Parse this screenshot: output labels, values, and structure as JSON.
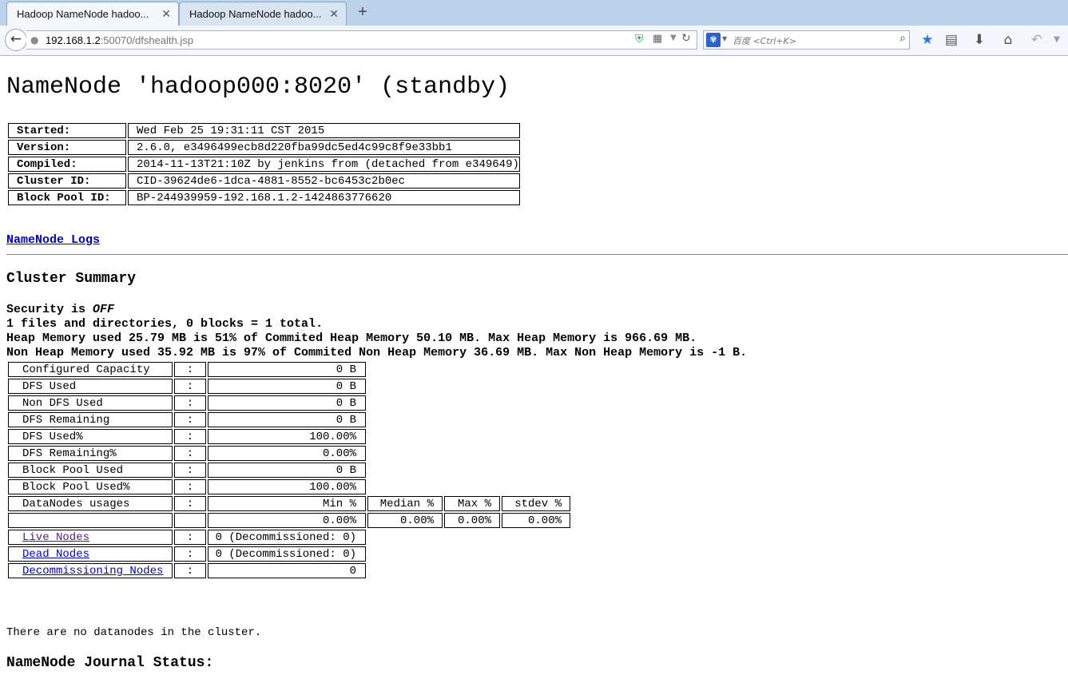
{
  "browser": {
    "tabs": [
      {
        "title": "Hadoop NameNode hadoo..."
      },
      {
        "title": "Hadoop NameNode hadoo..."
      }
    ],
    "new_tab_label": "+",
    "close_label": "✕",
    "url_host": "192.168.1.2",
    "url_rest": ":50070/dfshealth.jsp",
    "search_placeholder": "百度 <Ctrl+K>"
  },
  "page": {
    "title": "NameNode 'hadoop000:8020' (standby)",
    "info": [
      {
        "key": "Started:",
        "value": "Wed Feb 25 19:31:11 CST 2015"
      },
      {
        "key": "Version:",
        "value": "2.6.0, e3496499ecb8d220fba99dc5ed4c99c8f9e33bb1"
      },
      {
        "key": "Compiled:",
        "value": "2014-11-13T21:10Z by jenkins from (detached from e349649)"
      },
      {
        "key": "Cluster ID:",
        "value": "CID-39624de6-1dca-4881-8552-bc6453c2b0ec"
      },
      {
        "key": "Block Pool ID:",
        "value": "BP-244939959-192.168.1.2-1424863776620"
      }
    ],
    "logs_link": "NameNode Logs",
    "cluster_summary_heading": "Cluster Summary",
    "security_prefix": "Security is ",
    "security_value": "OFF",
    "files_line": "1 files and directories, 0 blocks = 1 total.",
    "heap_line": "Heap Memory used 25.79 MB is 51% of Commited Heap Memory 50.10 MB. Max Heap Memory is 966.69 MB.",
    "nonheap_line": "Non Heap Memory used 35.92 MB is 97% of Commited Non Heap Memory 36.69 MB. Max Non Heap Memory is -1 B.",
    "separator": ":",
    "capacity": [
      {
        "key": "Configured Capacity",
        "value": "0 B"
      },
      {
        "key": "DFS Used",
        "value": "0 B"
      },
      {
        "key": "Non DFS Used",
        "value": "0 B"
      },
      {
        "key": "DFS Remaining",
        "value": "0 B"
      },
      {
        "key": "DFS Used%",
        "value": "100.00%"
      },
      {
        "key": "DFS Remaining%",
        "value": "0.00%"
      },
      {
        "key": "Block Pool Used",
        "value": "0 B"
      },
      {
        "key": "Block Pool Used%",
        "value": "100.00%"
      }
    ],
    "datanodes_usages": {
      "label": "DataNodes usages",
      "headers": [
        "Min %",
        "Median %",
        "Max %",
        "stdev %"
      ],
      "values": [
        "0.00%",
        "0.00%",
        "0.00%",
        "0.00%"
      ]
    },
    "live_nodes": {
      "label": "Live Nodes",
      "value": "0 (Decommissioned: 0)"
    },
    "dead_nodes": {
      "label": "Dead Nodes",
      "value": "0 (Decommissioned: 0)"
    },
    "decommissioning_nodes": {
      "label": "Decommissioning Nodes",
      "value": "0"
    },
    "no_datanodes": "There are no datanodes in the cluster.",
    "journal_heading": "NameNode Journal Status:"
  }
}
